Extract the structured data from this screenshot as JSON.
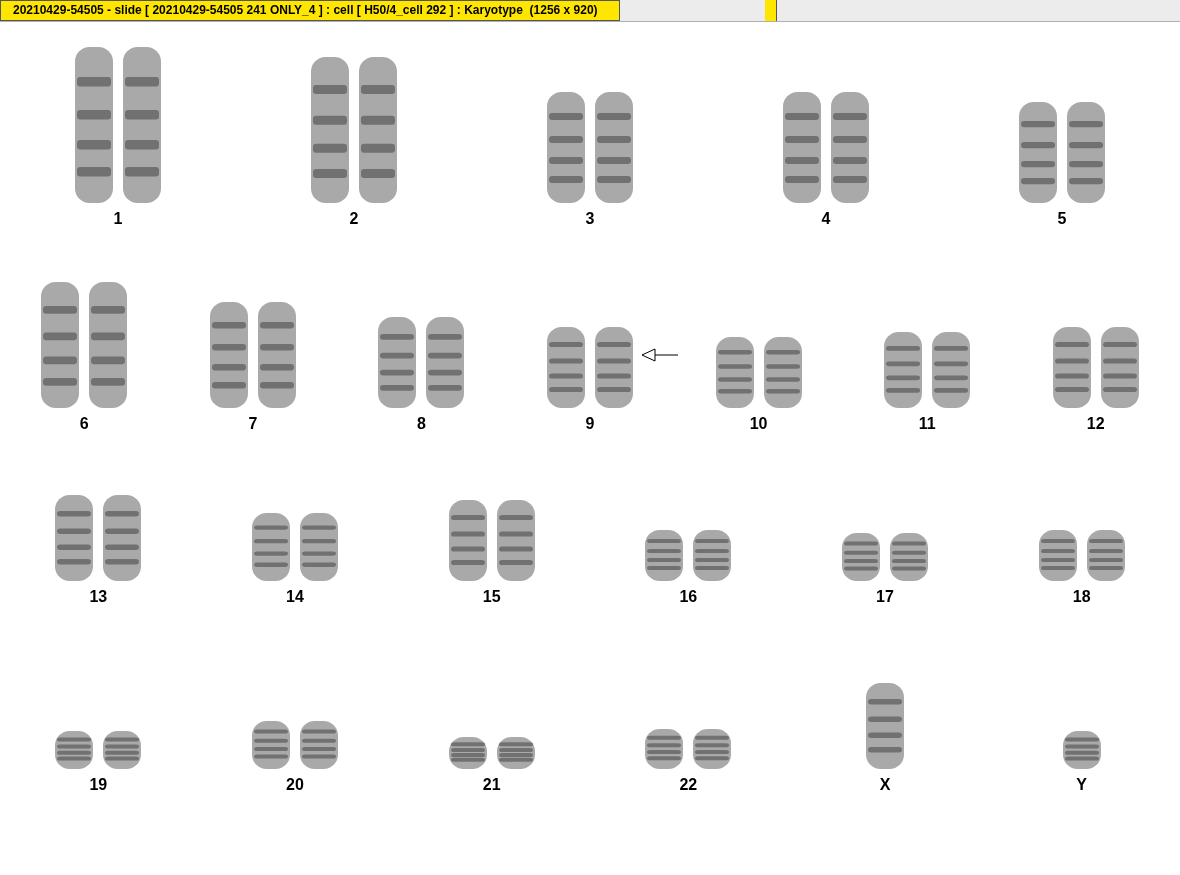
{
  "window": {
    "title": "20210429-54505 - slide [ 20210429-54505 241 ONLY_4 ] : cell [ H50/4_cell 292 ] : Karyotype  (1256 x 920)"
  },
  "karyotype": {
    "rows": [
      {
        "groups": [
          {
            "label": "1",
            "kind": "pair",
            "marked": false
          },
          {
            "label": "2",
            "kind": "pair",
            "marked": false
          },
          {
            "label": "3",
            "kind": "pair",
            "marked": false
          },
          {
            "label": "4",
            "kind": "pair",
            "marked": false
          },
          {
            "label": "5",
            "kind": "pair",
            "marked": false
          }
        ]
      },
      {
        "groups": [
          {
            "label": "6",
            "kind": "pair",
            "marked": false
          },
          {
            "label": "7",
            "kind": "pair",
            "marked": false
          },
          {
            "label": "8",
            "kind": "pair",
            "marked": false
          },
          {
            "label": "9",
            "kind": "pair",
            "marked": true
          },
          {
            "label": "10",
            "kind": "pair",
            "marked": false
          },
          {
            "label": "11",
            "kind": "pair",
            "marked": false
          },
          {
            "label": "12",
            "kind": "pair",
            "marked": false
          }
        ]
      },
      {
        "groups": [
          {
            "label": "13",
            "kind": "pair",
            "marked": false
          },
          {
            "label": "14",
            "kind": "pair",
            "marked": false
          },
          {
            "label": "15",
            "kind": "pair",
            "marked": false
          },
          {
            "label": "16",
            "kind": "pair",
            "marked": false
          },
          {
            "label": "17",
            "kind": "pair",
            "marked": false
          },
          {
            "label": "18",
            "kind": "pair",
            "marked": false
          }
        ]
      },
      {
        "groups": [
          {
            "label": "19",
            "kind": "pair",
            "marked": false
          },
          {
            "label": "20",
            "kind": "pair",
            "marked": false
          },
          {
            "label": "21",
            "kind": "pair",
            "marked": false
          },
          {
            "label": "22",
            "kind": "pair",
            "marked": false
          },
          {
            "label": "X",
            "kind": "single",
            "marked": false
          },
          {
            "label": "Y",
            "kind": "single",
            "marked": false
          }
        ]
      }
    ]
  }
}
